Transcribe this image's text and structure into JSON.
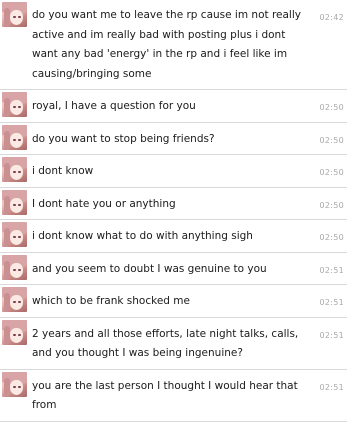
{
  "messages": [
    {
      "text": "do you want me to leave the rp cause im not really active and im really bad with posting plus i dont want any bad 'energy' in the rp and i feel like im causing/bringing some",
      "time": "02:42"
    },
    {
      "text": "royal, I have a question for you",
      "time": "02:50"
    },
    {
      "text": "do you want to stop being friends?",
      "time": "02:50"
    },
    {
      "text": "i dont know",
      "time": "02:50"
    },
    {
      "text": "I dont hate you or anything",
      "time": "02:50"
    },
    {
      "text": "i dont know what to do with anything sigh",
      "time": "02:50"
    },
    {
      "text": "and you seem to doubt I was genuine to you",
      "time": "02:51"
    },
    {
      "text": "which to be frank shocked me",
      "time": "02:51"
    },
    {
      "text": "2 years and all those efforts, late night talks, calls, and you thought I was being ingenuine?",
      "time": "02:51"
    },
    {
      "text": "you are the last person I thought I would hear that from",
      "time": "02:51"
    }
  ]
}
